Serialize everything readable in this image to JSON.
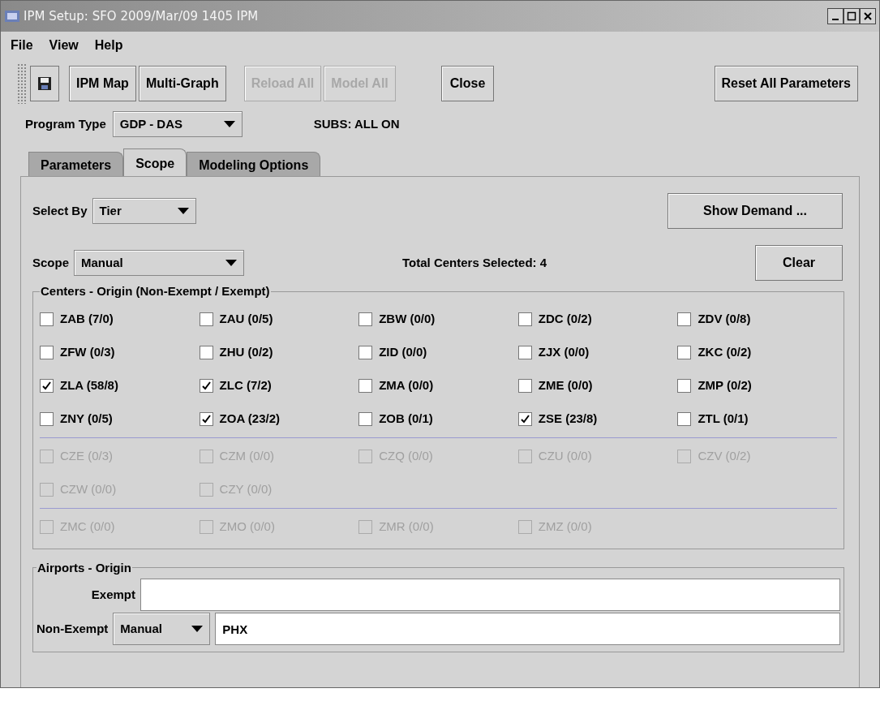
{
  "window": {
    "title": "IPM Setup: SFO 2009/Mar/09 1405 IPM"
  },
  "menu": [
    "File",
    "View",
    "Help"
  ],
  "toolbar": [
    {
      "label": "IPM Map",
      "disabled": false
    },
    {
      "label": "Multi-Graph",
      "disabled": false
    },
    {
      "label": "Reload All",
      "disabled": true
    },
    {
      "label": "Model All",
      "disabled": true
    },
    {
      "label": "Close",
      "disabled": false
    },
    {
      "label": "Reset All Parameters",
      "disabled": false
    }
  ],
  "program_type": {
    "label": "Program Type",
    "value": "GDP - DAS"
  },
  "subs": "SUBS: ALL ON",
  "tabs": [
    {
      "label": "Parameters",
      "selected": false
    },
    {
      "label": "Scope",
      "selected": true
    },
    {
      "label": "Modeling Options",
      "selected": false
    }
  ],
  "select_by": {
    "label": "Select By",
    "value": "Tier"
  },
  "show_demand": "Show Demand ...",
  "scope": {
    "label": "Scope",
    "value": "Manual"
  },
  "total_selected": "Total Centers Selected: 4",
  "clear": "Clear",
  "centers": {
    "title": "Centers - Origin (Non-Exempt / Exempt)",
    "groups": [
      [
        {
          "label": "ZAB (7/0)",
          "checked": false,
          "disabled": false
        },
        {
          "label": "ZAU (0/5)",
          "checked": false,
          "disabled": false
        },
        {
          "label": "ZBW (0/0)",
          "checked": false,
          "disabled": false
        },
        {
          "label": "ZDC (0/2)",
          "checked": false,
          "disabled": false
        },
        {
          "label": "ZDV (0/8)",
          "checked": false,
          "disabled": false
        },
        {
          "label": "ZFW (0/3)",
          "checked": false,
          "disabled": false
        },
        {
          "label": "ZHU (0/2)",
          "checked": false,
          "disabled": false
        },
        {
          "label": "ZID (0/0)",
          "checked": false,
          "disabled": false
        },
        {
          "label": "ZJX (0/0)",
          "checked": false,
          "disabled": false
        },
        {
          "label": "ZKC (0/2)",
          "checked": false,
          "disabled": false
        },
        {
          "label": "ZLA (58/8)",
          "checked": true,
          "disabled": false
        },
        {
          "label": "ZLC (7/2)",
          "checked": true,
          "disabled": false
        },
        {
          "label": "ZMA (0/0)",
          "checked": false,
          "disabled": false
        },
        {
          "label": "ZME (0/0)",
          "checked": false,
          "disabled": false
        },
        {
          "label": "ZMP (0/2)",
          "checked": false,
          "disabled": false
        },
        {
          "label": "ZNY (0/5)",
          "checked": false,
          "disabled": false
        },
        {
          "label": "ZOA (23/2)",
          "checked": true,
          "disabled": false
        },
        {
          "label": "ZOB (0/1)",
          "checked": false,
          "disabled": false
        },
        {
          "label": "ZSE (23/8)",
          "checked": true,
          "disabled": false
        },
        {
          "label": "ZTL (0/1)",
          "checked": false,
          "disabled": false
        }
      ],
      [
        {
          "label": "CZE (0/3)",
          "checked": false,
          "disabled": true
        },
        {
          "label": "CZM (0/0)",
          "checked": false,
          "disabled": true
        },
        {
          "label": "CZQ (0/0)",
          "checked": false,
          "disabled": true
        },
        {
          "label": "CZU (0/0)",
          "checked": false,
          "disabled": true
        },
        {
          "label": "CZV (0/2)",
          "checked": false,
          "disabled": true
        },
        {
          "label": "CZW (0/0)",
          "checked": false,
          "disabled": true
        },
        {
          "label": "CZY (0/0)",
          "checked": false,
          "disabled": true
        }
      ],
      [
        {
          "label": "ZMC (0/0)",
          "checked": false,
          "disabled": true
        },
        {
          "label": "ZMO (0/0)",
          "checked": false,
          "disabled": true
        },
        {
          "label": "ZMR (0/0)",
          "checked": false,
          "disabled": true
        },
        {
          "label": "ZMZ (0/0)",
          "checked": false,
          "disabled": true
        }
      ]
    ]
  },
  "airports": {
    "title": "Airports - Origin",
    "exempt_label": "Exempt",
    "non_exempt_label": "Non-Exempt",
    "non_exempt_mode": "Manual",
    "non_exempt_value": "PHX"
  }
}
